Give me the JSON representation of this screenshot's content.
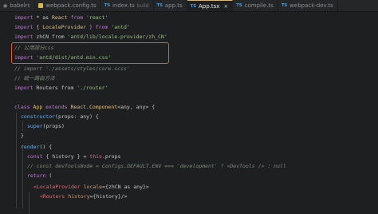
{
  "tabs": [
    {
      "icon": "folder-dim-icon",
      "label": "babelrc",
      "active": false
    },
    {
      "icon": "js-icon",
      "label": "webpack.config.ts",
      "active": false
    },
    {
      "icon": "ts-icon",
      "icon_text": "TS",
      "label": "index.ts",
      "sublabel": "build",
      "active": false
    },
    {
      "icon": "ts-icon",
      "icon_text": "TS",
      "label": "app.ts",
      "active": false
    },
    {
      "icon": "ts-icon",
      "icon_text": "TS",
      "label": "App.tsx",
      "close": "×",
      "active": true
    },
    {
      "icon": "ts-icon",
      "icon_text": "TS",
      "label": "compile.ts",
      "active": false
    },
    {
      "icon": "ts-icon",
      "icon_text": "TS",
      "label": "webpack-dev.ts",
      "active": false
    }
  ],
  "code": {
    "line1": {
      "k": "import",
      "a": " * as ",
      "b": "React",
      "c": " from ",
      "d": "'react'"
    },
    "line2": {
      "k": "import",
      "a": " { ",
      "b": "LocaleProvider",
      "c": " } from ",
      "d": "'antd'"
    },
    "line3": {
      "k": "import",
      "a": " zhCN from ",
      "d": "'antd/lib/locale-provider/zh_CN'"
    },
    "line4": {
      "comment": "// 公用部分css"
    },
    "line5": {
      "k": "import",
      "d": " 'antd/dist/antd.min.css'"
    },
    "line6": {
      "comment": "// import './assets/styles/core.scss'"
    },
    "line7": {
      "comment": "// 统一路由方法"
    },
    "line8": {
      "k": "import",
      "a": " Routers from ",
      "d": "'./router'"
    },
    "line9": {
      "k": "class",
      "b": " App ",
      "k2": "extends",
      "c": " React.Component",
      "d": "<any, any> {"
    },
    "line10": {
      "fn": "constructor",
      "a": "(props: any) {"
    },
    "line11": {
      "k": "super",
      "a": "(props)"
    },
    "line12": {
      "a": "}"
    },
    "line13": {
      "fn": "render",
      "a": "() {"
    },
    "line14": {
      "k": "const",
      "a": " { history } = ",
      "b": "this",
      "c": ".props"
    },
    "line15": {
      "comment": "// const devToolsNode = Configs.DEFAULT.ENV === 'development' ? <DevTools /> : null"
    },
    "line16": {
      "k": "return",
      "a": " ("
    },
    "line17": {
      "t": "<LocaleProvider",
      "at": " locale",
      "a": "={zhCN as any}>"
    },
    "line18": {
      "t": "<Routers",
      "at": " history",
      "a": "={history}/>"
    }
  }
}
